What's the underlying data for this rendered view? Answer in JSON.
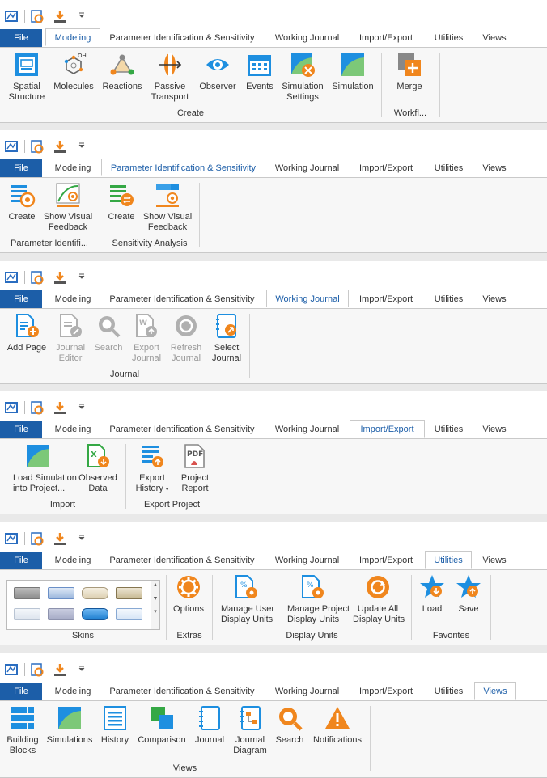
{
  "tabs": {
    "file": "File",
    "modeling": "Modeling",
    "param": "Parameter Identification & Sensitivity",
    "journal": "Working Journal",
    "import": "Import/Export",
    "utilities": "Utilities",
    "views": "Views"
  },
  "modeling": {
    "spatial_1": "Spatial",
    "spatial_2": "Structure",
    "molecules": "Molecules",
    "reactions": "Reactions",
    "passive_1": "Passive",
    "passive_2": "Transport",
    "observer": "Observer",
    "events": "Events",
    "simset_1": "Simulation",
    "simset_2": "Settings",
    "simulation": "Simulation",
    "merge": "Merge",
    "group_create": "Create",
    "group_workflow": "Workfl..."
  },
  "param": {
    "pi_create": "Create",
    "pi_show_1": "Show Visual",
    "pi_show_2": "Feedback",
    "sa_create": "Create",
    "sa_show_1": "Show Visual",
    "sa_show_2": "Feedback",
    "group_pi": "Parameter Identifi...",
    "group_sa": "Sensitivity Analysis"
  },
  "journal": {
    "add_page": "Add Page",
    "editor_1": "Journal",
    "editor_2": "Editor",
    "search": "Search",
    "export_1": "Export",
    "export_2": "Journal",
    "refresh_1": "Refresh",
    "refresh_2": "Journal",
    "select_1": "Select",
    "select_2": "Journal",
    "group": "Journal"
  },
  "importexport": {
    "load_1": "Load Simulation",
    "load_2": "into Project...",
    "observed_1": "Observed",
    "observed_2": "Data",
    "export_1": "Export",
    "export_2": "History",
    "report_1": "Project",
    "report_2": "Report",
    "group_import": "Import",
    "group_export": "Export Project",
    "pdf_text": "PDF"
  },
  "utilities": {
    "options": "Options",
    "user_units_1": "Manage User",
    "user_units_2": "Display Units",
    "project_units_1": "Manage Project",
    "project_units_2": "Display Units",
    "update_units_1": "Update All",
    "update_units_2": "Display Units",
    "load": "Load",
    "save": "Save",
    "group_skins": "Skins",
    "group_extras": "Extras",
    "group_units": "Display Units",
    "group_fav": "Favorites"
  },
  "views": {
    "blocks_1": "Building",
    "blocks_2": "Blocks",
    "simulations": "Simulations",
    "history": "History",
    "comparison": "Comparison",
    "journal": "Journal",
    "diagram_1": "Journal",
    "diagram_2": "Diagram",
    "search": "Search",
    "notifications": "Notifications",
    "group": "Views"
  },
  "colors": {
    "accent": "#1c5ea8",
    "blue": "#1e8fe0",
    "orange": "#f0861d",
    "green": "#35a845",
    "disabled": "#b0b0b0"
  }
}
